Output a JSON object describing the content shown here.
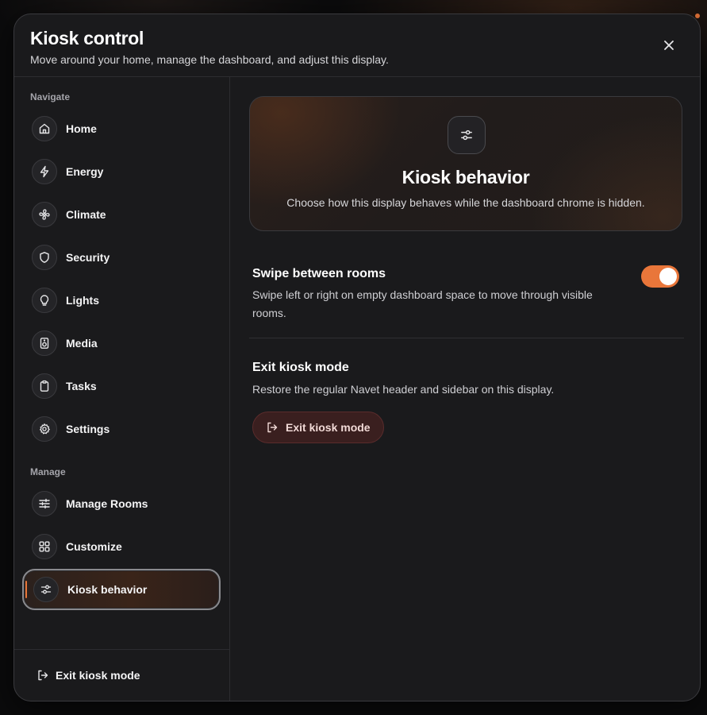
{
  "header": {
    "title": "Kiosk control",
    "subtitle": "Move around your home, manage the dashboard, and adjust this display."
  },
  "sidebar": {
    "navigate_label": "Navigate",
    "navigate_items": [
      {
        "label": "Home",
        "icon": "home-icon"
      },
      {
        "label": "Energy",
        "icon": "lightning-icon"
      },
      {
        "label": "Climate",
        "icon": "fan-icon"
      },
      {
        "label": "Security",
        "icon": "shield-icon"
      },
      {
        "label": "Lights",
        "icon": "lightbulb-icon"
      },
      {
        "label": "Media",
        "icon": "speaker-icon"
      },
      {
        "label": "Tasks",
        "icon": "clipboard-icon"
      },
      {
        "label": "Settings",
        "icon": "gear-icon"
      }
    ],
    "manage_label": "Manage",
    "manage_items": [
      {
        "label": "Manage Rooms",
        "icon": "sliders-icon"
      },
      {
        "label": "Customize",
        "icon": "grid-icon"
      },
      {
        "label": "Kiosk behavior",
        "icon": "toggles-icon",
        "active": true
      }
    ],
    "footer_exit_label": "Exit kiosk mode"
  },
  "content": {
    "hero": {
      "title": "Kiosk behavior",
      "description": "Choose how this display behaves while the dashboard chrome is hidden."
    },
    "swipe": {
      "title": "Swipe between rooms",
      "description_line1": "Swipe left or right on empty dashboard space to move through visible",
      "description_line2": "rooms.",
      "enabled": true
    },
    "exit": {
      "title": "Exit kiosk mode",
      "description": "Restore the regular Navet header and sidebar on this display.",
      "button_label": "Exit kiosk mode"
    }
  },
  "colors": {
    "accent": "#e9763a",
    "panel": "#1a1a1c",
    "danger_bg": "#3a1f1f"
  }
}
